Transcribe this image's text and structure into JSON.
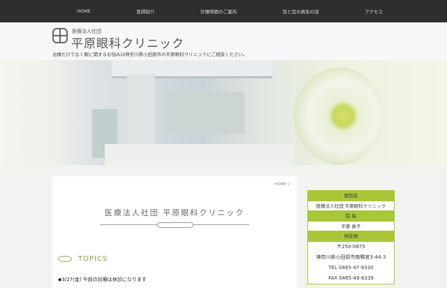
{
  "nav": [
    "HOME",
    "医師紹介",
    "診療時間のご案内",
    "目と目の病気の話",
    "アクセス"
  ],
  "header": {
    "subtitle": "医療法人社団",
    "title": "平原眼科クリニック",
    "tagline": "治療だけでなく眼に関するお悩みは神奈川県小田原市の平原眼科クリニックにご相談ください。"
  },
  "main": {
    "breadcrumb": "HOME »",
    "page_title": "医療法人社団 平原眼科クリニック",
    "topics_heading": "TOPICS",
    "news_item": "◆3/27(金) 午前の診療は休診になります"
  },
  "sidebar": {
    "name_label": "医院名",
    "name": "医療法人社団 平原眼科クリニック",
    "director_label": "院 長",
    "director": "平原 敦子",
    "address_label": "所在地",
    "postal": "〒250-0875",
    "address": "神奈川県小田原市南鴨宮3-44-3",
    "tel": "TEL 0465-47-9330",
    "fax": "FAX 0465-49-6339"
  },
  "colors": {
    "accent": "#a9c638",
    "nav_bg": "#2e2e2e"
  }
}
